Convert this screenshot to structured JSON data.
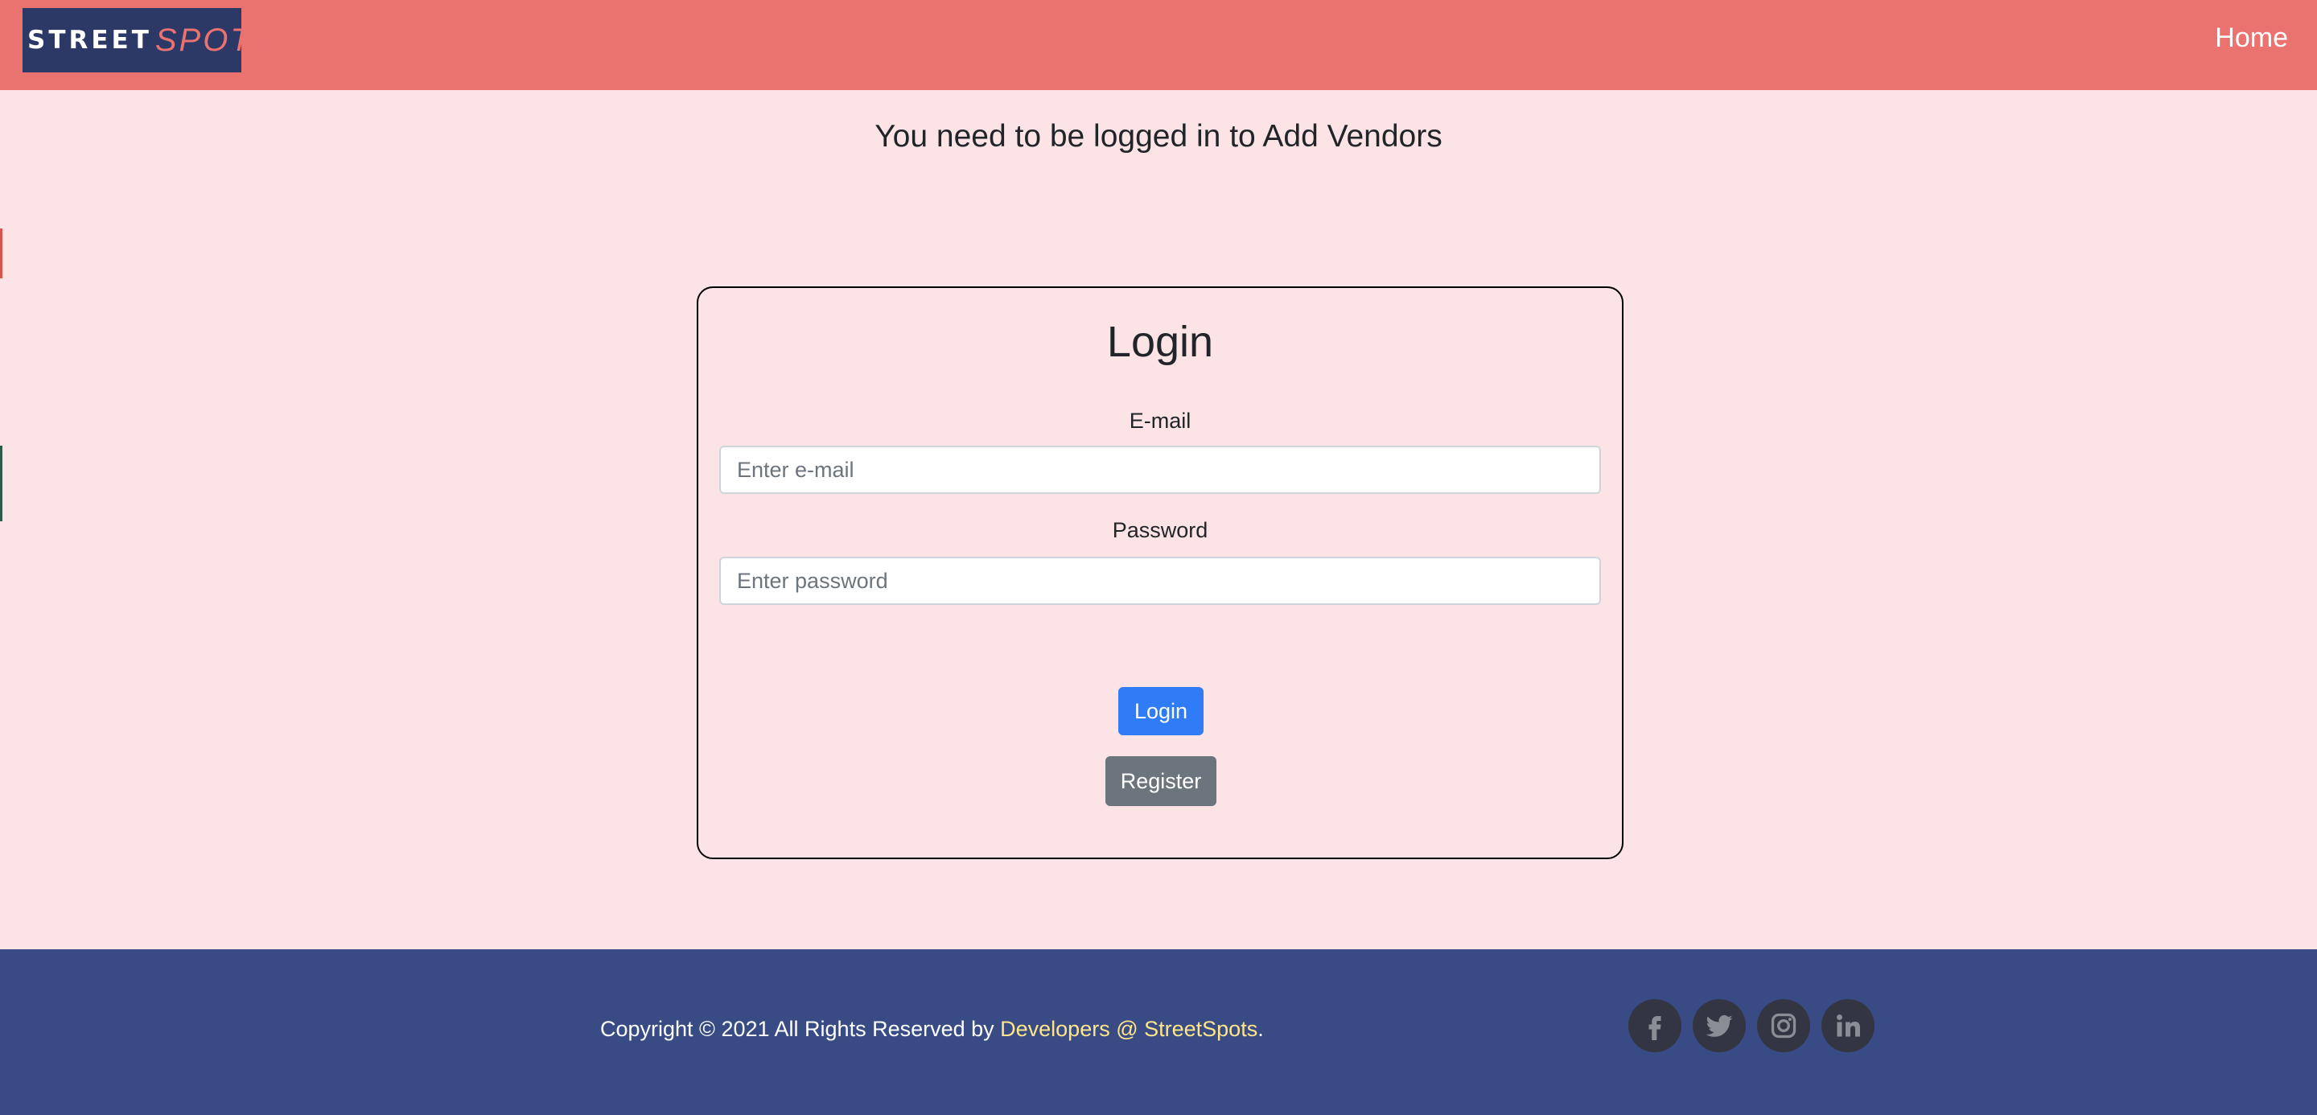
{
  "header": {
    "logo_street": "STREET",
    "logo_spots": "SPOTS",
    "home_label": "Home"
  },
  "notice": "You need to be logged in to Add Vendors",
  "login_card": {
    "title": "Login",
    "email_label": "E-mail",
    "email_placeholder": "Enter e-mail",
    "password_label": "Password",
    "password_placeholder": "Enter password",
    "login_button": "Login",
    "register_button": "Register"
  },
  "footer": {
    "copyright_prefix": "Copyright © 2021 All Rights Reserved by ",
    "developers_link": "Developers @ StreetSpots",
    "copyright_suffix": ".",
    "social_icons": [
      "facebook-icon",
      "twitter-icon",
      "instagram-icon",
      "linkedin-icon"
    ]
  },
  "colors": {
    "header_bg": "#ea7370",
    "page_bg": "#fce4e6",
    "footer_bg": "#394b84",
    "login_button": "#2f7cf6",
    "register_button": "#6c757d",
    "link": "#ffe58a"
  }
}
